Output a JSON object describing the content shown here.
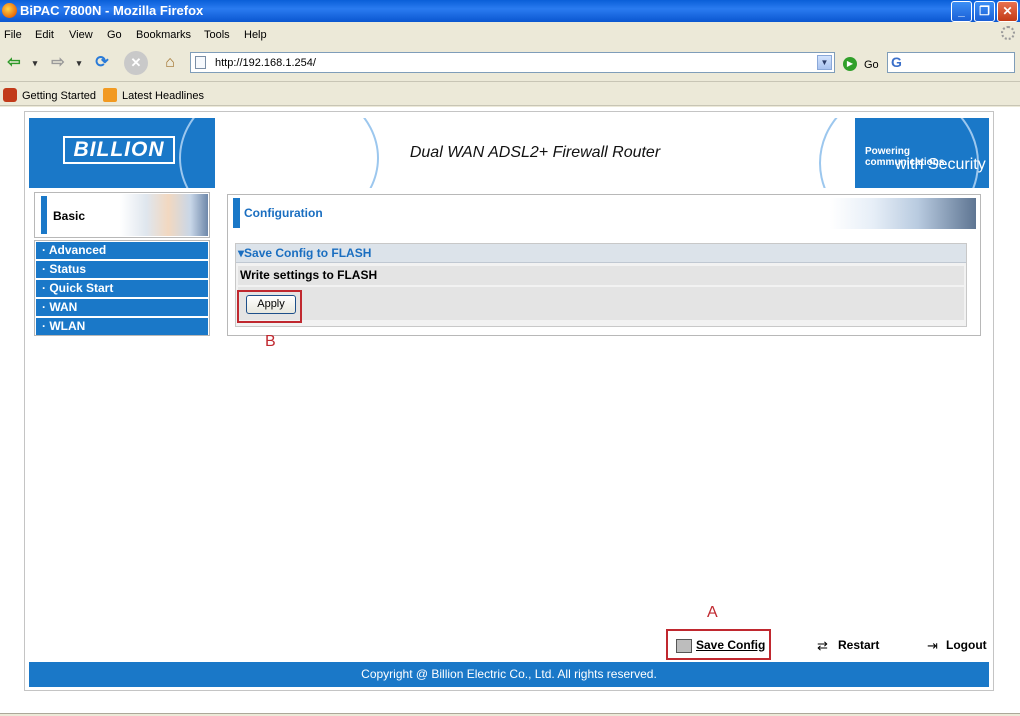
{
  "window": {
    "title": "BiPAC 7800N - Mozilla Firefox"
  },
  "menu": {
    "items": [
      "File",
      "Edit",
      "View",
      "Go",
      "Bookmarks",
      "Tools",
      "Help"
    ]
  },
  "nav": {
    "url": "http://192.168.1.254/",
    "go_label": "Go"
  },
  "bookmarks": {
    "items": [
      "Getting Started",
      "Latest Headlines"
    ]
  },
  "banner": {
    "logo": "BILLION",
    "title": "Dual WAN ADSL2+ Firewall Router",
    "tagline_1": "Powering communications",
    "tagline_2": "with Security"
  },
  "sidebar": {
    "header": "Basic",
    "items": [
      "· Advanced",
      "· Status",
      "· Quick Start",
      "· WAN",
      "· WLAN"
    ]
  },
  "main": {
    "title": "Configuration",
    "section_title": "▾Save Config to FLASH",
    "row_text": "Write settings to FLASH",
    "apply_label": "Apply"
  },
  "annotations": {
    "b": "B",
    "a": "A"
  },
  "actions": {
    "save": "Save Config",
    "restart": "Restart",
    "logout": "Logout"
  },
  "footer": {
    "copyright": "Copyright @ Billion Electric Co., Ltd. All rights reserved."
  },
  "colors": {
    "brand_blue": "#1a78c8",
    "highlight_red": "#c0282f"
  },
  "icons": [
    "firefox-icon",
    "back-icon",
    "forward-icon",
    "reload-icon",
    "stop-icon",
    "home-icon",
    "go-icon",
    "google-icon",
    "save-icon",
    "restart-icon",
    "logout-icon"
  ]
}
